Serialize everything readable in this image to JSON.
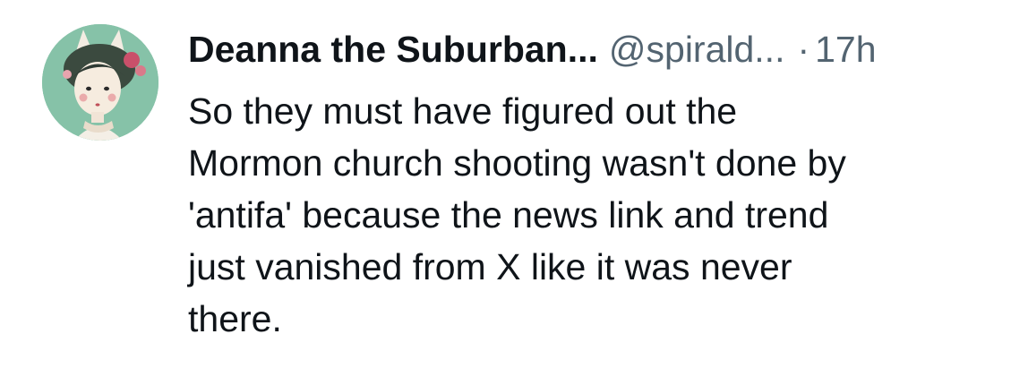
{
  "post": {
    "author": {
      "display_name": "Deanna the Suburban...",
      "handle": "@spirald...",
      "avatar_icon": "illustrated-girl-avatar"
    },
    "separator": "·",
    "timestamp": "17h",
    "text_lines": [
      "So they must have figured out the",
      "Mormon church shooting wasn't done by",
      "'antifa' because the news link and trend",
      "just vanished from X like it was never",
      "there."
    ]
  },
  "colors": {
    "text_primary": "#0f1419",
    "text_secondary": "#536471",
    "background": "#ffffff",
    "avatar_bg": "#7fbfa3"
  }
}
